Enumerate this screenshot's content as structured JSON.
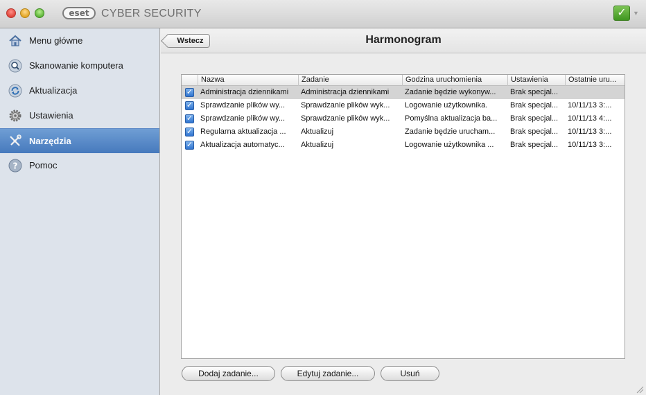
{
  "window": {
    "logo_text": "eset",
    "app_title": "CYBER SECURITY",
    "status_icon": "checkmark-icon",
    "status_color": "#4caf2a"
  },
  "sidebar": {
    "items": [
      {
        "label": "Menu główne",
        "icon": "home-icon"
      },
      {
        "label": "Skanowanie komputera",
        "icon": "magnifier-icon"
      },
      {
        "label": "Aktualizacja",
        "icon": "refresh-icon"
      },
      {
        "label": "Ustawienia",
        "icon": "gear-icon"
      },
      {
        "label": "Narzędzia",
        "icon": "tools-icon",
        "selected": true
      },
      {
        "label": "Pomoc",
        "icon": "help-icon"
      }
    ],
    "selected_color": "#5588c8"
  },
  "header": {
    "back_label": "Wstecz",
    "title": "Harmonogram"
  },
  "table": {
    "columns": [
      "Nazwa",
      "Zadanie",
      "Godzina uruchomienia",
      "Ustawienia",
      "Ostatnie uru..."
    ],
    "rows": [
      {
        "checked": true,
        "selected": true,
        "cells": [
          "Administracja dziennikami",
          "Administracja dziennikami",
          "Zadanie będzie wykonyw...",
          "Brak specjal...",
          ""
        ]
      },
      {
        "checked": true,
        "cells": [
          "Sprawdzanie plików wy...",
          "Sprawdzanie plików wyk...",
          "Logowanie użytkownika.",
          "Brak specjal...",
          "10/11/13 3:..."
        ]
      },
      {
        "checked": true,
        "cells": [
          "Sprawdzanie plików wy...",
          "Sprawdzanie plików wyk...",
          "Pomyślna aktualizacja ba...",
          "Brak specjal...",
          "10/11/13 4:..."
        ]
      },
      {
        "checked": true,
        "cells": [
          "Regularna aktualizacja ...",
          "Aktualizuj",
          "Zadanie będzie urucham...",
          "Brak specjal...",
          "10/11/13 3:..."
        ]
      },
      {
        "checked": true,
        "cells": [
          "Aktualizacja automatyc...",
          "Aktualizuj",
          "Logowanie użytkownika ...",
          "Brak specjal...",
          "10/11/13 3:..."
        ]
      }
    ]
  },
  "buttons": {
    "add": "Dodaj zadanie...",
    "edit": "Edytuj zadanie...",
    "delete": "Usuń"
  }
}
